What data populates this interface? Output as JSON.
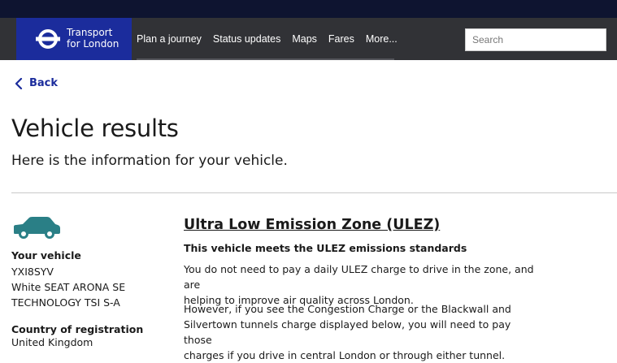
{
  "header": {
    "logo_line1": "Transport",
    "logo_line2": "for London",
    "nav": [
      "Plan a journey",
      "Status updates",
      "Maps",
      "Fares",
      "More..."
    ],
    "search_placeholder": "Search"
  },
  "colors": {
    "top_band": "#0e1430",
    "header_bg": "#313236",
    "logo_bg": "#1b2c9c",
    "back_link": "#1b2c9c",
    "car_icon": "#2a7f86"
  },
  "back": {
    "label": "Back",
    "icon": "chevron-left-icon"
  },
  "page": {
    "title": "Vehicle results",
    "subtitle": "Here is the information for your vehicle."
  },
  "vehicle": {
    "icon": "car-icon",
    "your_vehicle_label": "Your vehicle",
    "registration": "YXI8SYV",
    "description_line1": "White SEAT ARONA SE",
    "description_line2": "TECHNOLOGY TSI S-A",
    "country_label": "Country of registration",
    "country": "United Kingdom"
  },
  "zone": {
    "title": "Ultra Low Emission Zone (ULEZ)",
    "status": "This vehicle meets the ULEZ emissions standards",
    "para1_line1": "You do not need to pay a daily ULEZ charge to drive in the zone, and are",
    "para1_line2": "helping to improve air quality across London.",
    "para2_line1": "However, if you see the Congestion Charge or the Blackwall and",
    "para2_line2": "Silvertown tunnels charge displayed below, you will need to pay those",
    "para2_line3": "charges if you drive in central London or through either tunnel."
  }
}
